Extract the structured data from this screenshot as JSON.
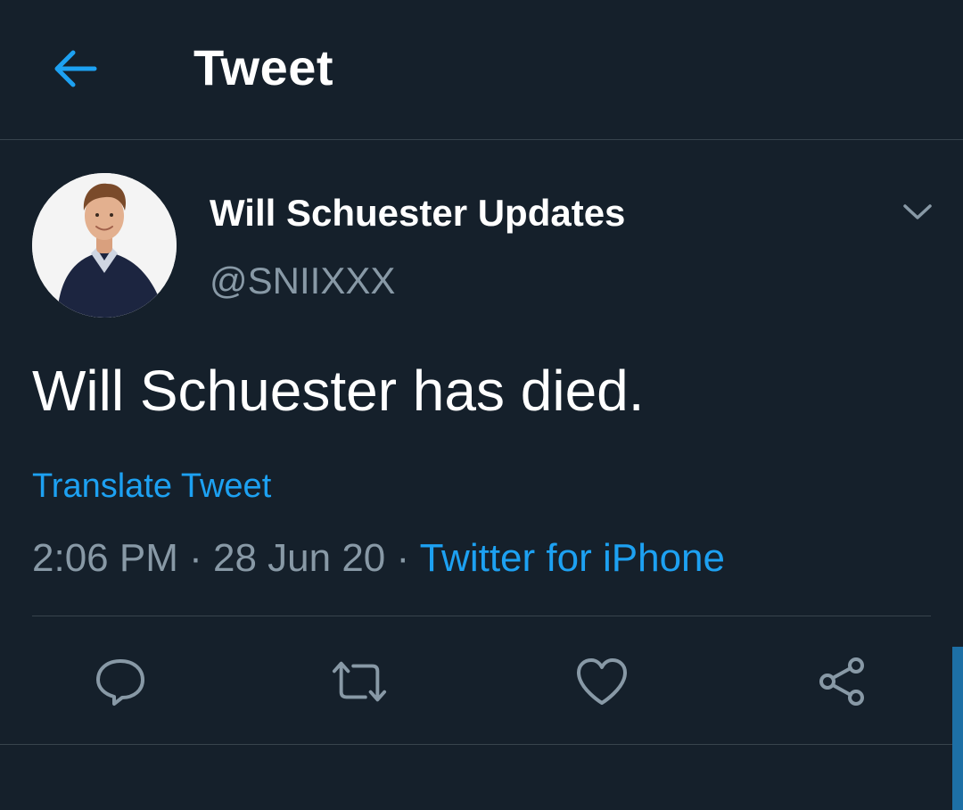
{
  "header": {
    "title": "Tweet",
    "back_icon": "arrow-left-icon"
  },
  "author": {
    "display_name": "Will Schuester Updates",
    "handle": "@SNIIXXX",
    "menu_icon": "chevron-down-icon"
  },
  "tweet": {
    "text": "Will Schuester has died.",
    "translate_label": "Translate Tweet",
    "time": "2:06 PM",
    "separator": "·",
    "date": "28 Jun 20",
    "source": "Twitter for iPhone"
  },
  "actions": [
    {
      "name": "reply",
      "icon": "reply-icon"
    },
    {
      "name": "retweet",
      "icon": "retweet-icon"
    },
    {
      "name": "like",
      "icon": "heart-icon"
    },
    {
      "name": "share",
      "icon": "share-icon"
    }
  ],
  "colors": {
    "background": "#15202b",
    "accent": "#1da1f2",
    "secondary_text": "#8899a6",
    "divider": "#38444d"
  }
}
